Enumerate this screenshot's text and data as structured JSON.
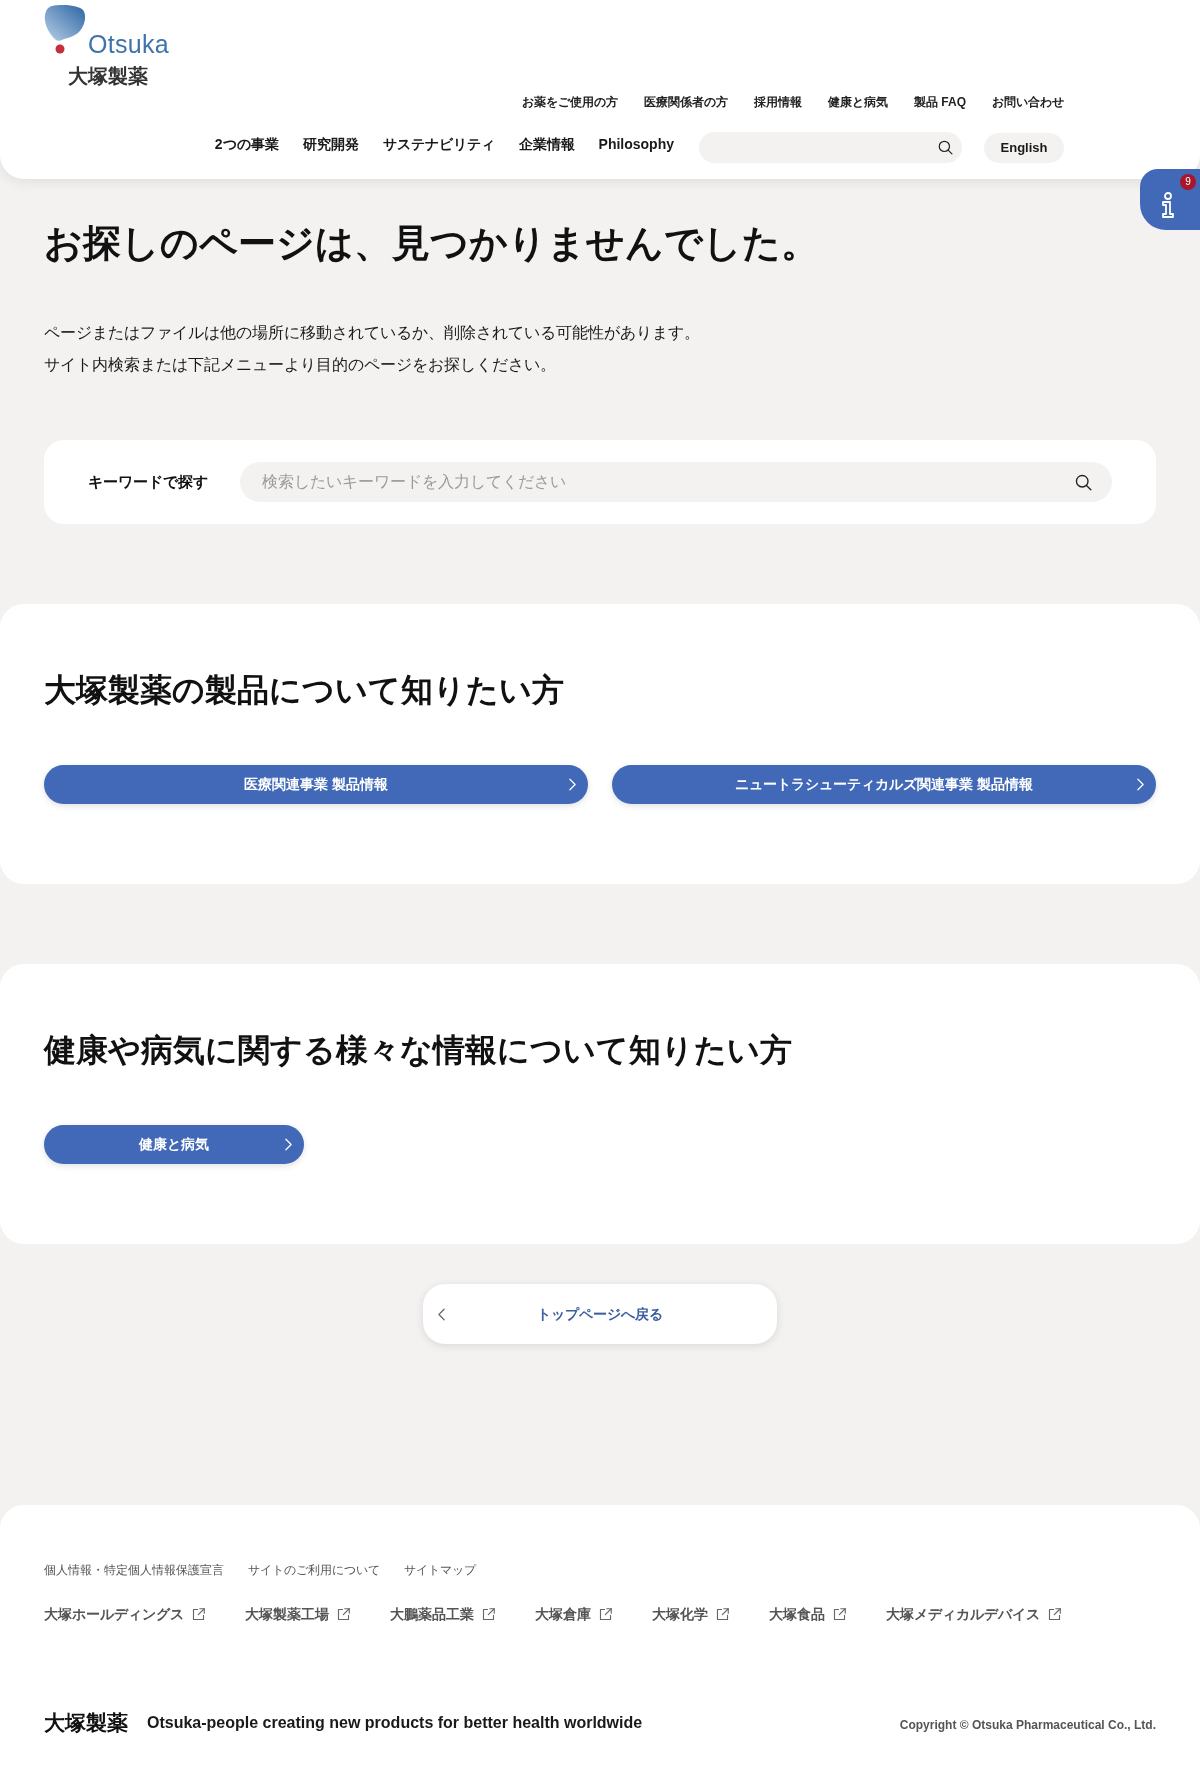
{
  "logo": {
    "wordmark": "Otsuka",
    "name": "大塚製薬"
  },
  "utility_nav": [
    "お薬をご使用の方",
    "医療関係者の方",
    "採用情報",
    "健康と病気",
    "製品 FAQ",
    "お問い合わせ"
  ],
  "main_nav": [
    "2つの事業",
    "研究開発",
    "サステナビリティ",
    "企業情報",
    "Philosophy"
  ],
  "language_button": "English",
  "info_button": {
    "badge": "9"
  },
  "error": {
    "title": "お探しのページは、見つかりませんでした。",
    "lines": [
      "ページまたはファイルは他の場所に移動されているか、削除されている可能性があります。",
      "サイト内検索または下記メニューより目的のページをお探しください。"
    ]
  },
  "keyword_search": {
    "label": "キーワードで探す",
    "placeholder": "検索したいキーワードを入力してください"
  },
  "sections": [
    {
      "title": "大塚製薬の製品について知りたい方",
      "buttons": [
        "医療関連事業 製品情報",
        "ニュートラシューティカルズ関連事業 製品情報"
      ]
    },
    {
      "title": "健康や病気に関する様々な情報について知りたい方",
      "buttons": [
        "健康と病気"
      ]
    }
  ],
  "back_button": "トップページへ戻る",
  "footer": {
    "policy_links": [
      "個人情報・特定個人情報保護宣言",
      "サイトのご利用について",
      "サイトマップ"
    ],
    "group_links": [
      {
        "label": "大塚ホールディングス",
        "external": true
      },
      {
        "label": "大塚製薬工場",
        "external": true
      },
      {
        "label": "大鵬薬品工業",
        "external": true
      },
      {
        "label": "大塚倉庫",
        "external": true
      },
      {
        "label": "大塚化学",
        "external": true
      },
      {
        "label": "大塚食品",
        "external": true
      },
      {
        "label": "大塚メディカルデバイス",
        "external": true
      }
    ],
    "logo": "大塚製薬",
    "tagline": "Otsuka-people creating new products for better health worldwide",
    "copyright": "Copyright © Otsuka Pharmaceutical Co., Ltd."
  }
}
